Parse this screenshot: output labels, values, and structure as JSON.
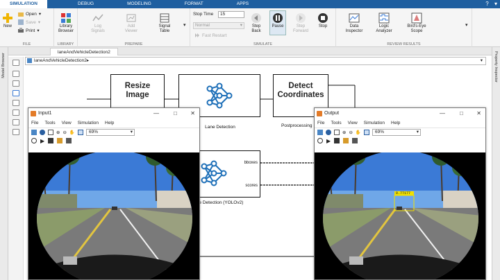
{
  "ribbon_tabs": [
    "SIMULATION",
    "DEBUG",
    "MODELING",
    "FORMAT",
    "APPS"
  ],
  "file_group": {
    "new_label": "New",
    "open_label": "Open",
    "save_label": "Save",
    "print_label": "Print",
    "group_label": "FILE"
  },
  "library_group": {
    "browser_label": "Library Browser",
    "group_label": "LIBRARY"
  },
  "prepare_group": {
    "log_signals": "Log Signals",
    "add_viewer": "Add Viewer",
    "signal_table": "Signal Table",
    "group_label": "PREPARE"
  },
  "simulate_group": {
    "stop_time_label": "Stop Time",
    "stop_time_value": "15",
    "mode_value": "Normal",
    "fast_restart": "Fast Restart",
    "step_back": "Step Back",
    "pause": "Pause",
    "step_forward": "Step Forward",
    "stop": "Stop",
    "group_label": "SIMULATE"
  },
  "review_group": {
    "data_inspector": "Data Inspector",
    "logic_analyzer": "Logic Analyzer",
    "birds_eye": "Bird's-Eye Scope",
    "group_label": "REVIEW RESULTS"
  },
  "model": {
    "tab_name": "laneAndVehicleDetection2",
    "address": "laneAndVehicleDetection2",
    "left_panel": "Model Browser",
    "right_panel": "Property Inspector"
  },
  "blocks": {
    "resize": "Resize Image",
    "lane_detection": "Lane Detection",
    "detect_coords": "Detect Coordinates",
    "postprocess": "Postprocessing",
    "yolo_label": "le Detection (YOLOv2)",
    "port_bboxes": "bboxes",
    "port_scores": "scores"
  },
  "input_window": {
    "title": "Input1",
    "menus": [
      "File",
      "Tools",
      "View",
      "Simulation",
      "Help"
    ],
    "zoom": "69%"
  },
  "output_window": {
    "title": "Output",
    "menus": [
      "File",
      "Tools",
      "View",
      "Simulation",
      "Help"
    ],
    "zoom": "69%",
    "detection_label": "0.77177"
  },
  "colors": {
    "ribbon_blue": "#1f5fa0",
    "detection_yellow": "#f1e000",
    "sim_icon_orange": "#e37b28"
  }
}
